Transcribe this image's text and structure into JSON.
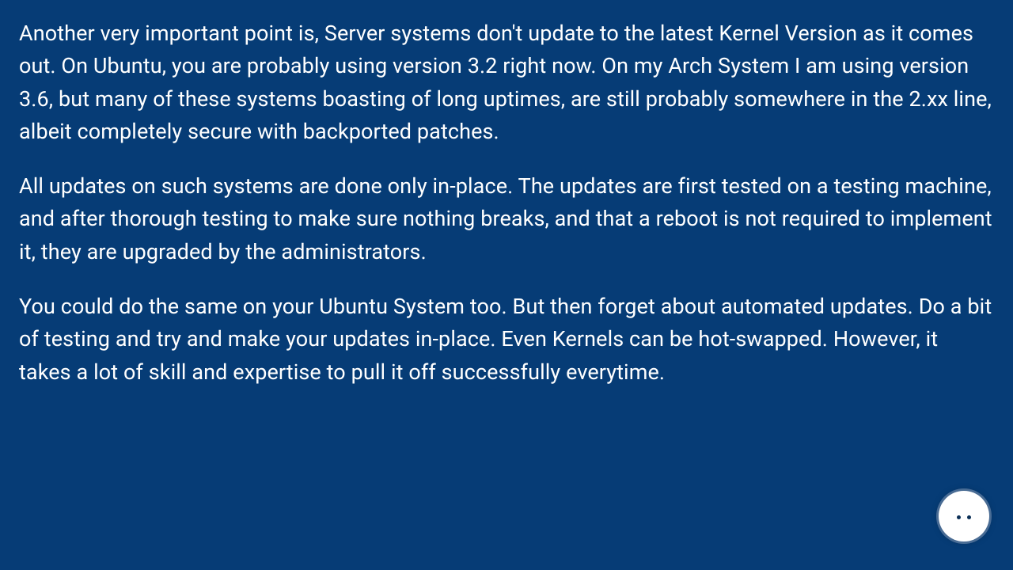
{
  "paragraphs": [
    "Another very important point is, Server systems don't update to the latest Kernel Version as it comes out. On Ubuntu, you are probably using version 3.2 right now. On my Arch System I am using version 3.6, but many of these systems boasting of long uptimes, are still probably somewhere in the 2.xx line, albeit completely secure with backported patches.",
    "All updates on such systems are done only in-place. The updates are first tested on a testing machine, and after thorough testing to make sure nothing breaks, and that a reboot is not required to implement it, they are upgraded by the administrators.",
    "You could do the same on your Ubuntu System too. But then forget about automated updates. Do a bit of testing and try and make your updates in-place. Even Kernels can be hot-swapped. However, it takes a lot of skill and expertise to pull it off successfully everytime."
  ],
  "avatar": {
    "name": "assistant-avatar"
  }
}
